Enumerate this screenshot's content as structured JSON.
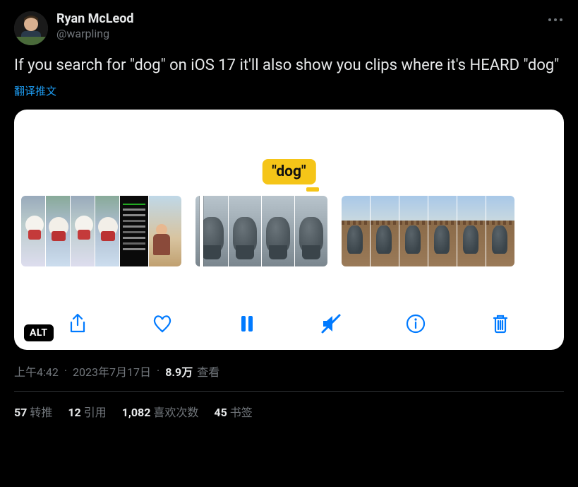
{
  "author": {
    "display_name": "Ryan McLeod",
    "handle": "@warpling"
  },
  "tweet_text": "If you search for \"dog\" on iOS 17 it'll also show you clips where it's HEARD \"dog\"",
  "translate_label": "翻译推文",
  "media": {
    "caption": "\"dog\"",
    "alt_badge": "ALT",
    "controls": {
      "share": "share",
      "like": "like",
      "pause": "pause",
      "mute": "mute",
      "info": "info",
      "delete": "delete"
    }
  },
  "meta": {
    "time": "上午4:42",
    "date": "2023年7月17日",
    "views_count": "8.9万",
    "views_label": "查看"
  },
  "stats": {
    "retweets": {
      "count": "57",
      "label": "转推"
    },
    "quotes": {
      "count": "12",
      "label": "引用"
    },
    "likes": {
      "count": "1,082",
      "label": "喜欢次数"
    },
    "bookmarks": {
      "count": "45",
      "label": "书签"
    }
  }
}
